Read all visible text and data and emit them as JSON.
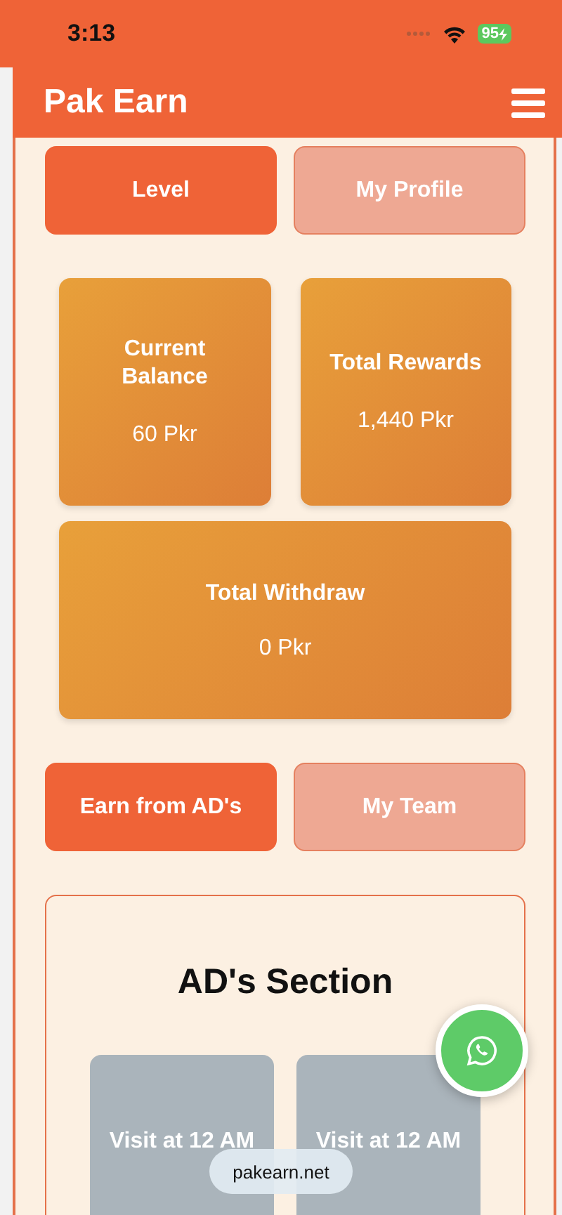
{
  "status_bar": {
    "time": "3:13",
    "battery": "95"
  },
  "header": {
    "title": "Pak Earn"
  },
  "top_tabs": [
    {
      "label": "Level",
      "selected": true
    },
    {
      "label": "My Profile",
      "selected": false
    }
  ],
  "stats": [
    {
      "label": "Current Balance",
      "value": "60 Pkr",
      "wide": false
    },
    {
      "label": "Total Rewards",
      "value": "1,440 Pkr",
      "wide": false
    },
    {
      "label": "Total Withdraw",
      "value": "0 Pkr",
      "wide": true
    }
  ],
  "bottom_tabs": [
    {
      "label": "Earn from AD's",
      "selected": true
    },
    {
      "label": "My Team",
      "selected": false
    }
  ],
  "ads_section": {
    "title": "AD's Section",
    "ads": [
      {
        "label": "Visit at 12 AM"
      },
      {
        "label": "Visit at 12 AM"
      }
    ]
  },
  "url_bar": {
    "address": "pakearn.net"
  }
}
